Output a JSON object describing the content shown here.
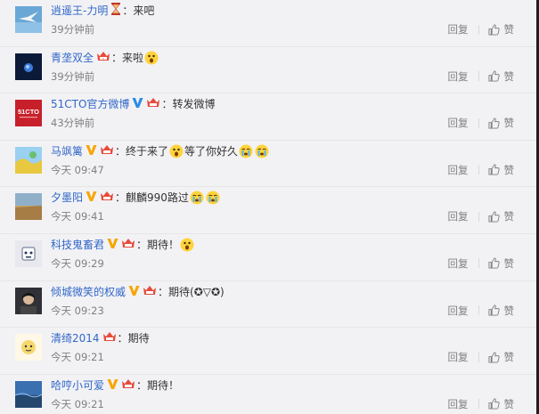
{
  "actions": {
    "reply_label": "回复",
    "like_label": "赞"
  },
  "comments": [
    {
      "user": "逍遥王-力明",
      "badge": "hourglass",
      "content": "来吧",
      "emoji": [],
      "time": "39分钟前"
    },
    {
      "user": "青垄双全",
      "badge": "crown",
      "content": "来啦",
      "emoji": [
        "surprised-face"
      ],
      "time": "39分钟前"
    },
    {
      "user": "51CTO官方微博",
      "badge": "verified-blue+crown",
      "content": "转发微博",
      "emoji": [],
      "time": "43分钟前"
    },
    {
      "user": "马飒篱",
      "badge": "verified-orange+crown",
      "content": "终于来了",
      "content2": "等了你好久",
      "emoji": [
        "surprised-face",
        "crying-face",
        "crying-face"
      ],
      "time": "今天 09:47"
    },
    {
      "user": "夕墨阳",
      "badge": "verified-orange+crown",
      "content": "麒麟990路过",
      "emoji": [
        "crying-face",
        "crying-face"
      ],
      "time": "今天 09:41"
    },
    {
      "user": "科技鬼畜君",
      "badge": "verified-orange+crown",
      "content": "期待！",
      "emoji": [
        "surprised-face"
      ],
      "time": "今天 09:29"
    },
    {
      "user": "倾城微笑的权威",
      "badge": "verified-orange+crown",
      "content": "期待(✪▽✪)",
      "emoji": [],
      "time": "今天 09:23"
    },
    {
      "user": "清绮2014",
      "badge": "crown",
      "content": "期待",
      "emoji": [],
      "time": "今天 09:21"
    },
    {
      "user": "哈哼小可爱",
      "badge": "verified-orange+crown",
      "content": "期待！",
      "emoji": [],
      "time": "今天 09:21"
    }
  ],
  "colors": {
    "link": "#3167c8",
    "meta": "#808080",
    "background": "#f2f2f5",
    "verified_orange": "#f7a600",
    "verified_blue": "#2a8ce6",
    "crown": "#e64c3c"
  }
}
